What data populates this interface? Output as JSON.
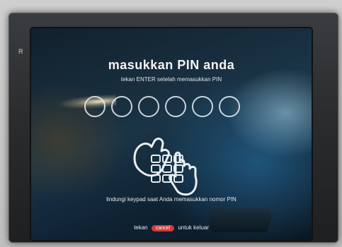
{
  "bezel": {
    "mark": "R"
  },
  "screen": {
    "title": "masukkan PIN anda",
    "subtitle": "tekan ENTER setelah memasukkan PIN",
    "pin_slots": 6,
    "pin_entered": 0,
    "instruction": "lindungi keypad saat Anda memasukkan nomor PIN",
    "footer": {
      "prefix": "tekan",
      "cancel_key": "cancel",
      "suffix": "untuk keluar"
    }
  },
  "icons": {
    "keypad_illustration": "hand-covering-keypad-icon"
  },
  "colors": {
    "cancel_key": "#d13b3b",
    "text": "#f4f4f4"
  }
}
